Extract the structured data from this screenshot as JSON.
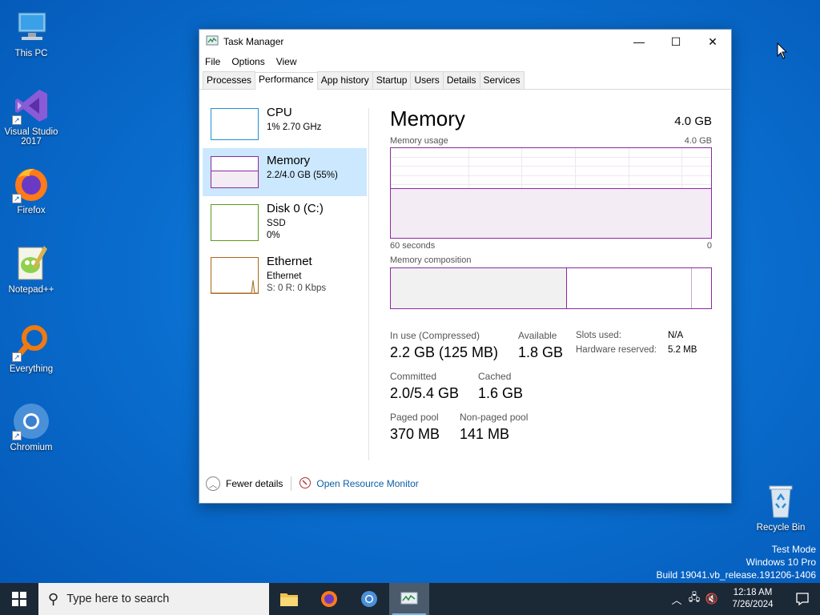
{
  "desktop": {
    "icons": [
      {
        "label": "This PC"
      },
      {
        "label": "Visual Studio 2017"
      },
      {
        "label": "Firefox"
      },
      {
        "label": "Notepad++"
      },
      {
        "label": "Everything"
      },
      {
        "label": "Chromium"
      },
      {
        "label": "Recycle Bin"
      }
    ],
    "watermark": {
      "line1": "Test Mode",
      "line2": "Windows 10 Pro",
      "line3": "Build 19041.vb_release.191206-1406"
    }
  },
  "window": {
    "title": "Task Manager",
    "controls": {
      "minimize": "—",
      "maximize": "☐",
      "close": "✕"
    },
    "menu": [
      "File",
      "Options",
      "View"
    ],
    "tabs": [
      "Processes",
      "Performance",
      "App history",
      "Startup",
      "Users",
      "Details",
      "Services"
    ],
    "active_tab": "Performance",
    "sidebar": [
      {
        "name": "CPU",
        "line1": "1%  2.70 GHz",
        "line2": "",
        "color": "#1e90d6"
      },
      {
        "name": "Memory",
        "line1": "2.2/4.0 GB (55%)",
        "line2": "",
        "color": "#8b2a9e"
      },
      {
        "name": "Disk 0 (C:)",
        "line1": "SSD",
        "line2": "0%",
        "color": "#5e9a1e"
      },
      {
        "name": "Ethernet",
        "line1": "Ethernet",
        "line2": "S: 0  R: 0 Kbps",
        "color": "#a86a1a"
      }
    ],
    "memory": {
      "title": "Memory",
      "total": "4.0 GB",
      "usage_label": "Memory usage",
      "usage_max": "4.0 GB",
      "x_left": "60 seconds",
      "x_right": "0",
      "usage_fraction": 0.55,
      "composition_label": "Memory composition",
      "composition": {
        "in_use": 0.55,
        "standby": 0.39,
        "free": 0.06
      },
      "stats": {
        "in_use_label": "In use (Compressed)",
        "in_use_value": "2.2 GB (125 MB)",
        "available_label": "Available",
        "available_value": "1.8 GB",
        "committed_label": "Committed",
        "committed_value": "2.0/5.4 GB",
        "cached_label": "Cached",
        "cached_value": "1.6 GB",
        "paged_label": "Paged pool",
        "paged_value": "370 MB",
        "nonpaged_label": "Non-paged pool",
        "nonpaged_value": "141 MB",
        "slots_label": "Slots used:",
        "slots_value": "N/A",
        "hw_label": "Hardware reserved:",
        "hw_value": "5.2 MB"
      }
    },
    "footer": {
      "fewer_details": "Fewer details",
      "resource_monitor": "Open Resource Monitor"
    }
  },
  "taskbar": {
    "search_placeholder": "Type here to search",
    "apps": [
      "file-explorer",
      "firefox",
      "chromium",
      "task-manager"
    ],
    "time": "12:18 AM",
    "date": "7/26/2024"
  },
  "colors": {
    "accent": "#0078d7",
    "memory": "#8b2a9e",
    "selection": "#cce8ff",
    "taskbar": "#1b2836"
  }
}
